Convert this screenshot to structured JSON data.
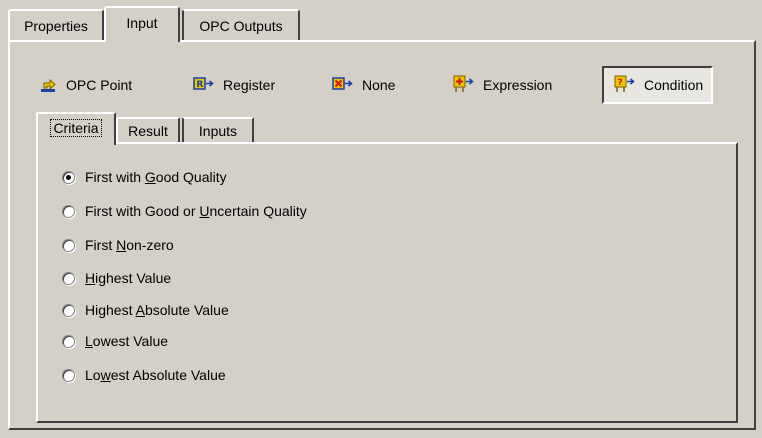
{
  "outer_tabs": [
    {
      "label": "Properties",
      "selected": false
    },
    {
      "label": "Input",
      "selected": true
    },
    {
      "label": "OPC Outputs",
      "selected": false
    }
  ],
  "sources": [
    {
      "label": "OPC Point",
      "icon": "opc-point-icon",
      "selected": false
    },
    {
      "label": "Register",
      "icon": "register-icon",
      "selected": false
    },
    {
      "label": "None",
      "icon": "none-icon",
      "selected": false
    },
    {
      "label": "Expression",
      "icon": "expression-icon",
      "selected": false
    },
    {
      "label": "Condition",
      "icon": "condition-icon",
      "selected": true
    }
  ],
  "inner_tabs": [
    {
      "label": "Criteria",
      "selected": true
    },
    {
      "label": "Result",
      "selected": false
    },
    {
      "label": "Inputs",
      "selected": false
    }
  ],
  "criteria": {
    "selected": 0,
    "options": [
      {
        "pre": "First with ",
        "mnemonic": "G",
        "post": "ood Quality"
      },
      {
        "pre": "First with Good or ",
        "mnemonic": "U",
        "post": "ncertain Quality"
      },
      {
        "pre": "First ",
        "mnemonic": "N",
        "post": "on-zero"
      },
      {
        "pre": "",
        "mnemonic": "H",
        "post": "ighest Value"
      },
      {
        "pre": "Highest ",
        "mnemonic": "A",
        "post": "bsolute Value"
      },
      {
        "pre": "",
        "mnemonic": "L",
        "post": "owest Value"
      },
      {
        "pre": "Lo",
        "mnemonic": "w",
        "post": "est Absolute Value"
      }
    ]
  },
  "colors": {
    "face": "#d4d0c8",
    "highlight": "#ffffff",
    "shadow": "#404040",
    "icon_yellow": "#e8c800",
    "icon_blue": "#1c3fa8",
    "icon_red": "#d81010"
  }
}
